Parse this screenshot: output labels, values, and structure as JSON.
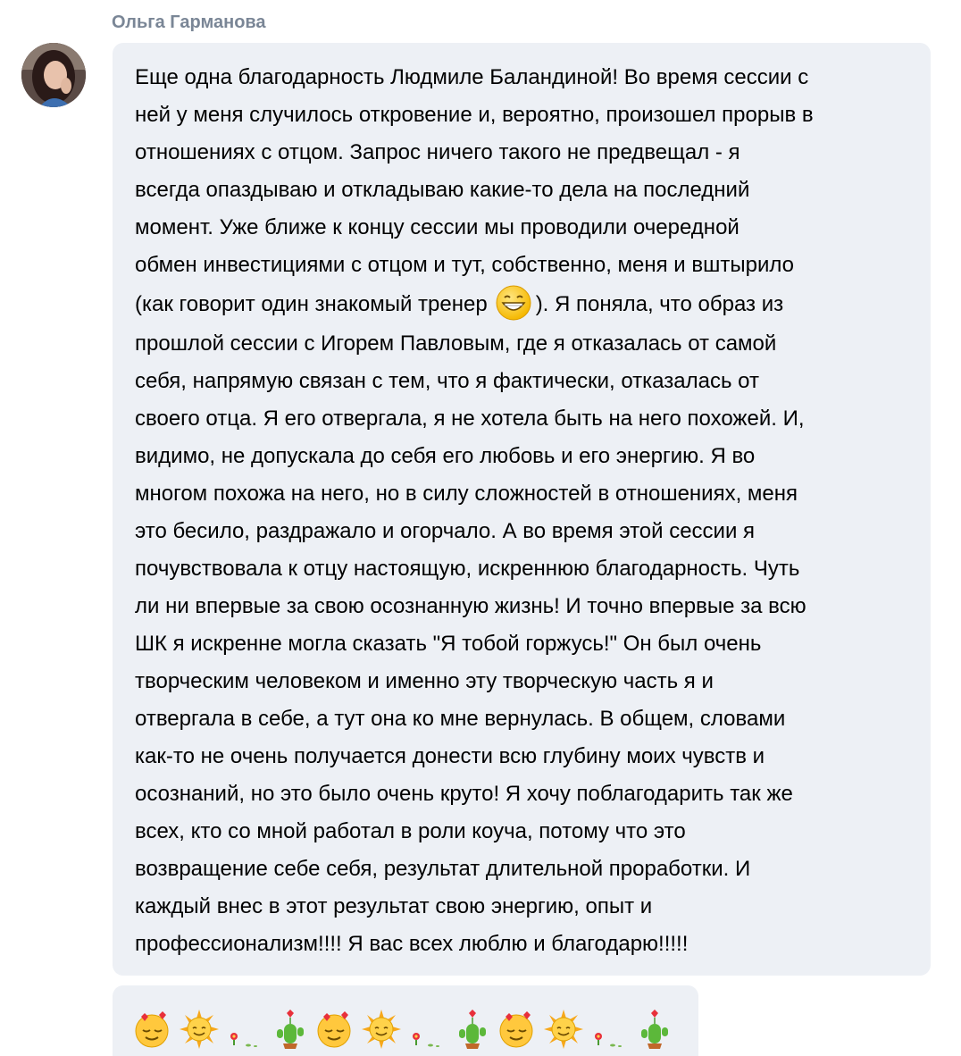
{
  "author": {
    "name": "Ольга Гарманова"
  },
  "message": {
    "lines": [
      "Еще одна благодарность Людмиле Баландиной! Во время сессии с",
      "ней у меня случилось откровение и, вероятно, произошел прорыв в",
      "отношениях с отцом. Запрос ничего такого не предвещал - я",
      "всегда опаздываю и откладываю какие-то дела на последний",
      "момент. Уже ближе к концу сессии мы проводили очередной",
      "обмен инвестициями с отцом и тут, собственно, меня и вштырило",
      "(как говорит один знакомый тренер",
      "). Я поняла, что образ из",
      "прошлой сессии с Игорем Павловым, где я отказалась от самой",
      "себя, напрямую связан с тем, что я фактически, отказалась от",
      "своего отца. Я его отвергала, я не хотела быть на него похожей. И,",
      "видимо, не допускала до себя его любовь и его энергию. Я во",
      "многом похожа на него, но в силу сложностей в отношениях, меня",
      "это бесило, раздражало и огорчало. А во время этой сессии я",
      "почувствовала к отцу настоящую, искреннюю благодарность. Чуть",
      "ли ни впервые за свою осознанную жизнь! И точно впервые за всю",
      "ШК я искренне могла сказать \"Я тобой горжусь!\" Он был очень",
      "творческим человеком и именно эту творческую часть я и",
      "отвергала в себе, а тут она ко мне вернулась. В общем, словами",
      "как-то не очень получается донести всю глубину моих чувств и",
      "осознаний, но это было очень круто! Я хочу поблагодарить так же",
      "всех, кто со мной работал в роли коуча, потому что это",
      "возвращение себе себя, результат длительной проработки. И",
      "каждый внес в этот результат свою энергию, опыт и",
      "профессионализм!!!! Я вас всех люблю и благодарю!!!!!"
    ],
    "inline_emoji": "grin-emoji"
  },
  "stickers": [
    "in-love-smiley",
    "sun-smiley",
    "flower-sprout",
    "cactus-with-heart",
    "in-love-smiley",
    "sun-smiley",
    "flower-sprout",
    "cactus-with-heart",
    "in-love-smiley",
    "sun-smiley",
    "flower-sprout",
    "cactus-with-heart"
  ],
  "colors": {
    "author_name": "#7a8696",
    "bubble_bg": "#edf0f5",
    "text": "#000000",
    "emoji_yellow": "#ffc83d"
  }
}
